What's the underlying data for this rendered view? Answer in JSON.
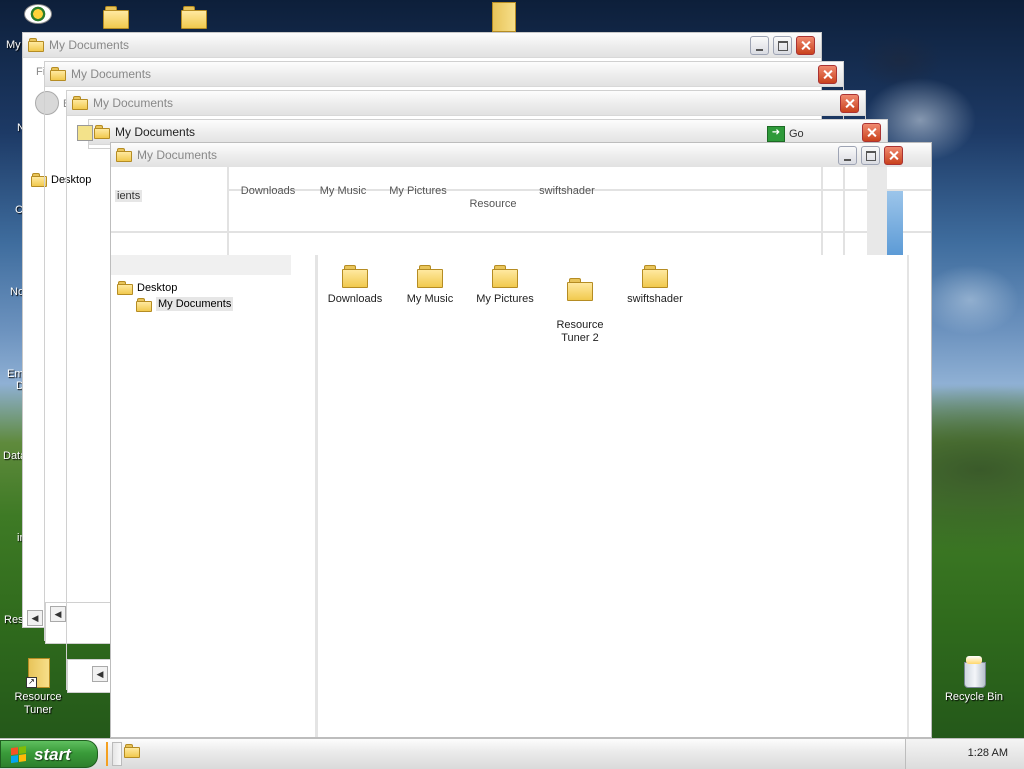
{
  "desktop": {
    "icons": {
      "resource_tuner": "Resource\nTuner",
      "recycle_bin": "Recycle Bin"
    },
    "cut_labels": [
      "My",
      "N",
      "C",
      "No",
      "Em",
      "D",
      "Data",
      "in",
      "Res"
    ]
  },
  "windows": {
    "title": "My Documents",
    "ghost_menu_fragment": "Fi",
    "ghost_back_fragment": "B",
    "go_label": "Go",
    "ghost_fragment_ents": "ients",
    "ghost_tree_desktop": "Desktop"
  },
  "front": {
    "tree": [
      {
        "label": "Desktop"
      },
      {
        "label": "My Documents"
      }
    ],
    "items": [
      {
        "label": "Downloads"
      },
      {
        "label": "My Music"
      },
      {
        "label": "My Pictures"
      },
      {
        "label": "Resource\nTuner 2"
      },
      {
        "label": "swiftshader"
      }
    ]
  },
  "taskbar": {
    "start_label": "start",
    "clock": "1:28 AM"
  },
  "colors": {
    "start_green": "#3a9b3a",
    "close_red": "#c9421d"
  }
}
